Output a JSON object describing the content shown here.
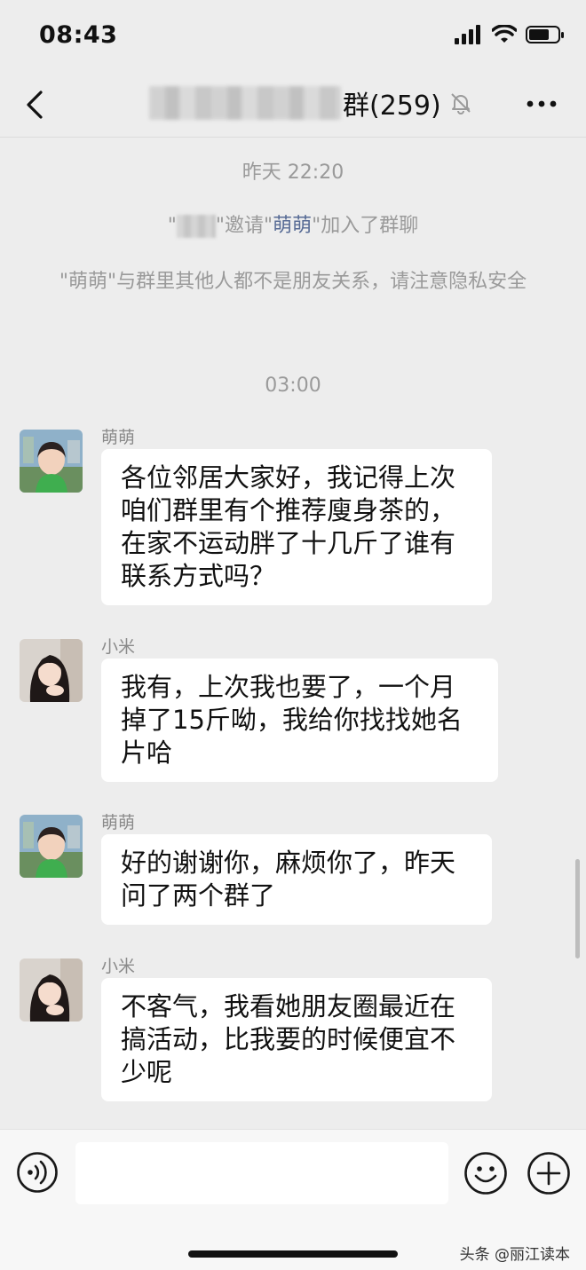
{
  "status_bar": {
    "time": "08:43"
  },
  "nav": {
    "title_suffix": "群(259)"
  },
  "system": {
    "ts1": "昨天 22:20",
    "invite_q1": "\"",
    "invite_mid": "\"邀请\"",
    "invite_name": "萌萌",
    "invite_end": "\"加入了群聊",
    "privacy": "\"萌萌\"与群里其他人都不是朋友关系，请注意隐私安全",
    "ts2": "03:00"
  },
  "messages": [
    {
      "sender": "萌萌",
      "text": "各位邻居大家好，我记得上次咱们群里有个推荐廋身茶的，在家不运动胖了十几斤了谁有联系方式吗？"
    },
    {
      "sender": "小米",
      "text": "我有，上次我也要了，一个月掉了15斤呦，我给你找找她名片哈"
    },
    {
      "sender": "萌萌",
      "text": "好的谢谢你，麻烦你了，昨天问了两个群了"
    },
    {
      "sender": "小米",
      "text": "不客气，我看她朋友圈最近在搞活动，比我要的时候便宜不少呢"
    }
  ],
  "watermark": "头条 @丽江读本",
  "colors": {
    "background": "#ededed",
    "bubble": "#ffffff",
    "link": "#576b95"
  },
  "icons": {
    "back": "chevron-left-icon",
    "mute": "bell-slash-icon",
    "more": "more-dots-icon",
    "voice": "voice-icon",
    "emoji": "emoji-icon",
    "plus": "plus-icon"
  }
}
